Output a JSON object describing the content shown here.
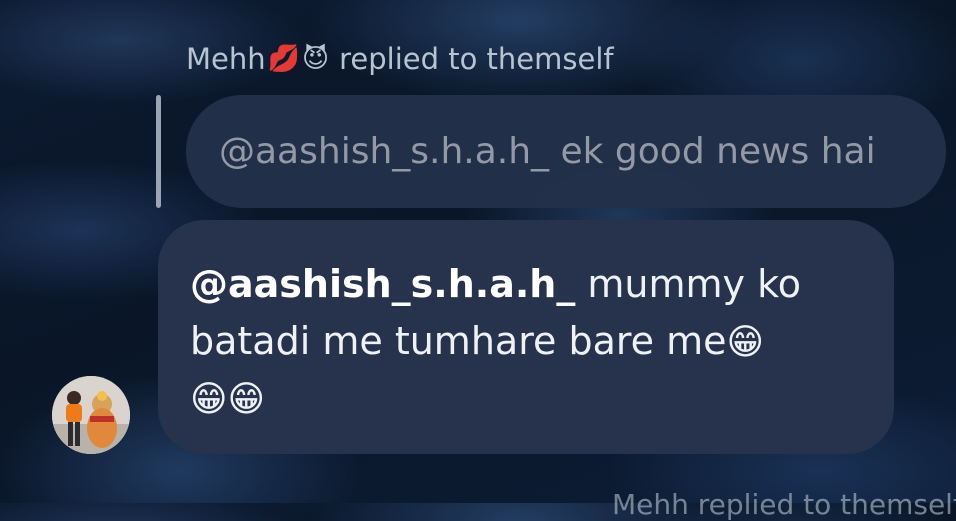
{
  "reply_header": {
    "sender_name": "Mehh",
    "sender_emojis": [
      "💋",
      "😈"
    ],
    "action_text": "replied to themself"
  },
  "quoted_message": {
    "text": "@aashish_s.h.a.h_ ek good news hai"
  },
  "message": {
    "mention": "@aashish_s.h.a.h_",
    "text_part_1": " mummy ko batadi me tumhare bare me",
    "emojis": [
      "😁",
      "😁",
      "😁"
    ]
  },
  "avatar": {
    "icon": "profile-photo"
  },
  "next_header_peek": {
    "text": "Mehh replied to themself"
  },
  "colors": {
    "bubble": "#27324c",
    "quoted_bubble": "#24304a",
    "header_text": "#b9c4d2",
    "quoted_text": "#939aa6"
  }
}
